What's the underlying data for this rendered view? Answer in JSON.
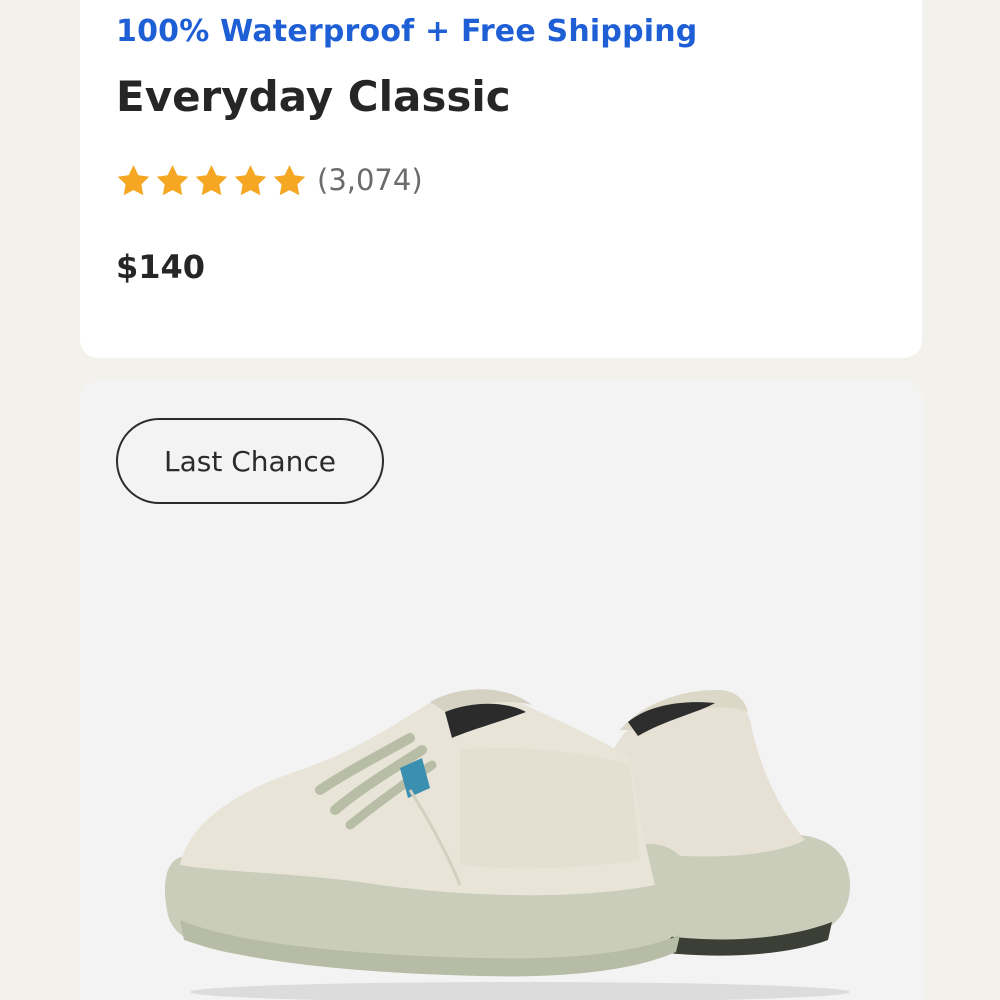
{
  "product": {
    "promo": "100% Waterproof + Free Shipping",
    "name": "Everyday Classic",
    "rating_stars": 5,
    "review_count": "(3,074)",
    "price": "$140",
    "badge": "Last Chance"
  },
  "colors": {
    "promo": "#1f5fd6",
    "star": "#f5a623",
    "background": "#f3f1ec",
    "image_card": "#f3f3f3"
  },
  "icons": {
    "rating": "star-icon",
    "product_image": "sneaker-image"
  }
}
